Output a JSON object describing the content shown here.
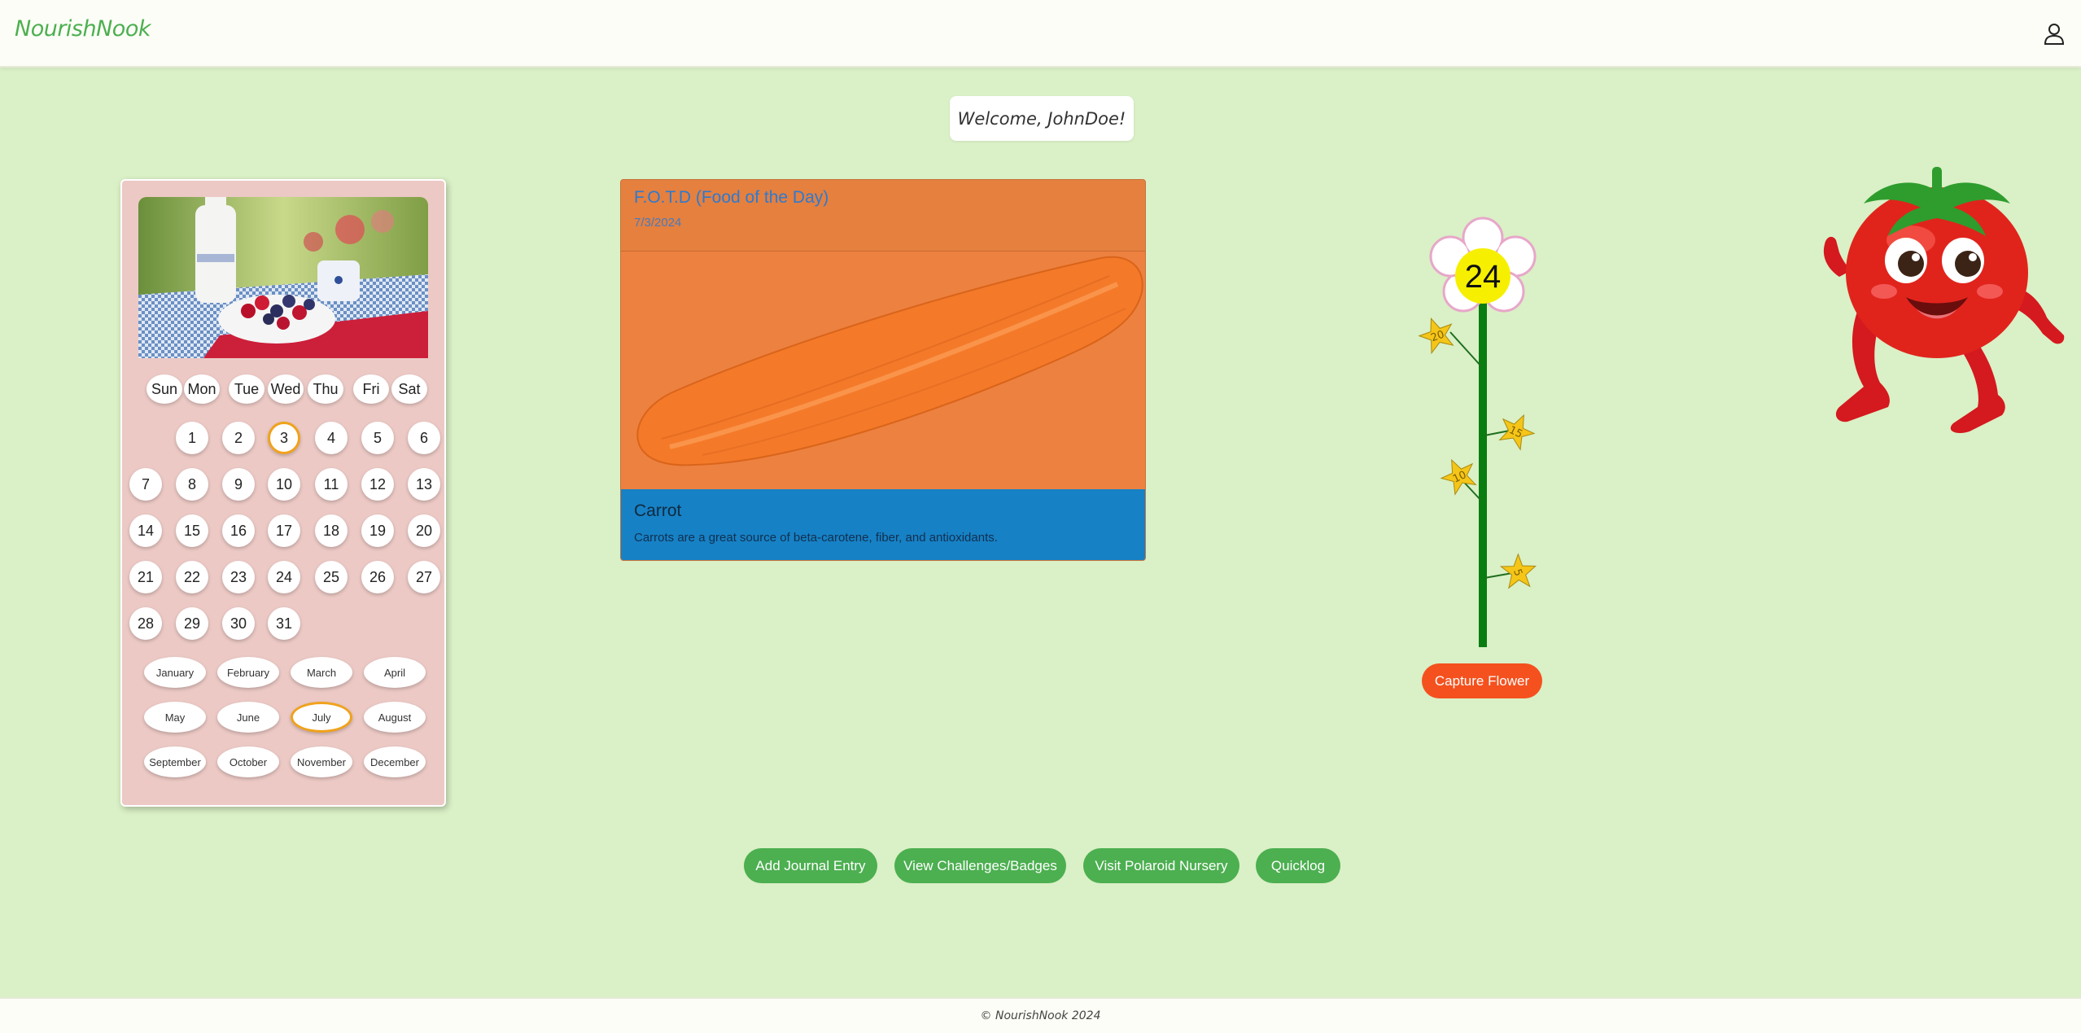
{
  "app": {
    "brand": "NourishNook"
  },
  "header": {
    "user_icon": "user-icon"
  },
  "welcome": {
    "text": "Welcome, JohnDoe!"
  },
  "calendar": {
    "weekdays": [
      "Sun",
      "Mon",
      "Tue",
      "Wed",
      "Thu",
      "Fri",
      "Sat"
    ],
    "days": [
      "1",
      "2",
      "3",
      "4",
      "5",
      "6",
      "7",
      "8",
      "9",
      "10",
      "11",
      "12",
      "13",
      "14",
      "15",
      "16",
      "17",
      "18",
      "19",
      "20",
      "21",
      "22",
      "23",
      "24",
      "25",
      "26",
      "27",
      "28",
      "29",
      "30",
      "31"
    ],
    "selected_day": "3",
    "months": [
      "January",
      "February",
      "March",
      "April",
      "May",
      "June",
      "July",
      "August",
      "September",
      "October",
      "November",
      "December"
    ],
    "selected_month": "July"
  },
  "food": {
    "title": "F.O.T.D (Food of the Day)",
    "date": "7/3/2024",
    "name": "Carrot",
    "description": "Carrots are a great source of beta-carotene, fiber, and antioxidants."
  },
  "flower": {
    "count": "24",
    "star_labels": [
      "20",
      "15",
      "10",
      "5"
    ],
    "capture_label": "Capture Flower"
  },
  "actions": {
    "journal": "Add Journal Entry",
    "challenges": "View Challenges/Badges",
    "nursery": "Visit Polaroid Nursery",
    "quicklog": "Quicklog"
  },
  "footer": {
    "text": "© NourishNook 2024"
  },
  "colors": {
    "background": "#daf0c6",
    "accent_green": "#4caf50",
    "capture_orange": "#f4511e",
    "food_header": "#e5803f",
    "food_body": "#1781c5",
    "calendar_bg": "#ecc9c5",
    "selected_ring": "#f0a21b"
  }
}
